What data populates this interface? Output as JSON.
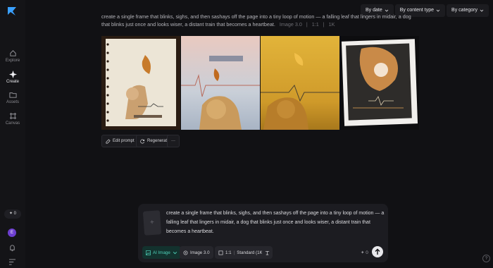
{
  "sidebar": {
    "items": [
      {
        "label": "Explore",
        "icon": "home-icon"
      },
      {
        "label": "Create",
        "icon": "sparkle-icon"
      },
      {
        "label": "Assets",
        "icon": "folder-icon"
      },
      {
        "label": "Canvas",
        "icon": "canvas-icon"
      }
    ],
    "credits": "0",
    "avatar": "E"
  },
  "filters": [
    {
      "label": "By date"
    },
    {
      "label": "By content type"
    },
    {
      "label": "By category"
    }
  ],
  "result": {
    "prompt": "create a single frame that blinks, sighs, and then sashays off the page into a tiny loop of motion — a falling leaf that lingers in midair, a dog that blinks just once and looks wiser, a distant train that becomes a heartbeat.",
    "model": "Image 3.0",
    "ratio": "1:1",
    "resolution": "1K"
  },
  "actions": {
    "edit_prompt": "Edit prompt",
    "regenerate": "Regenerate",
    "more": "···"
  },
  "composer": {
    "text": "create a single frame that blinks, sighs, and then sashays off the page into a tiny loop of motion — a falling leaf that lingers in midair, a dog that blinks just once and looks wiser, a distant train that becomes a heartbeat.",
    "thumb_plus": "+",
    "mode": "AI Image",
    "model": "Image 3.0",
    "ratio": "1:1",
    "quality": "Standard (1K)",
    "cost": "0"
  },
  "help": "?",
  "colors": {
    "accent": "#4fd1b9",
    "avatar": "#6d3fd0",
    "bg": "#111114"
  }
}
